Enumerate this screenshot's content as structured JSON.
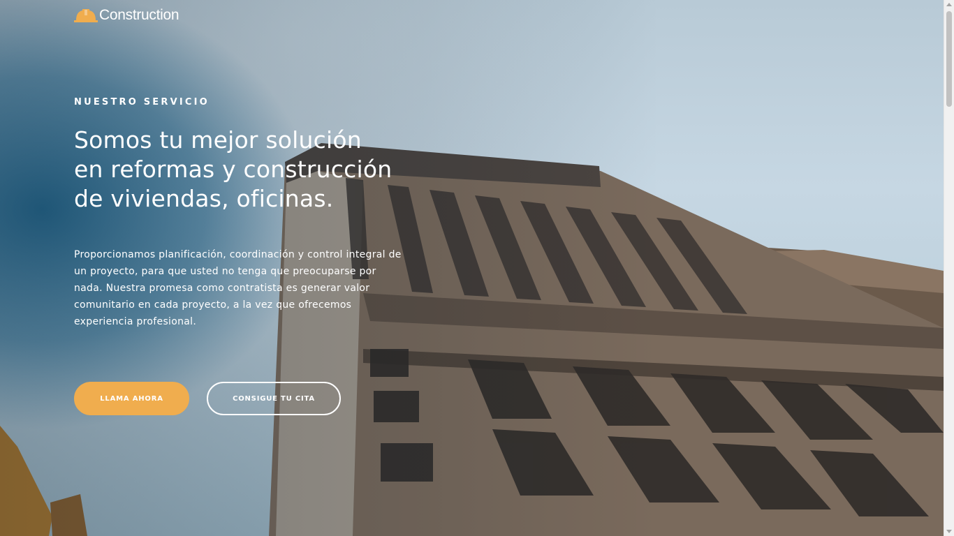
{
  "header": {
    "logo_text": "Construction",
    "logo_icon": "hard-hat-icon"
  },
  "hero": {
    "eyebrow": "NUESTRO SERVICIO",
    "headline": "Somos tu mejor solución en reformas y construcción de viviendas, oficinas.",
    "description": "Proporcionamos planificación, coordinación y control integral de un proyecto, para que usted no tenga que preocuparse por nada. Nuestra promesa como contratista es generar valor comunitario en cada proyecto, a la vez que ofrecemos experiencia profesional.",
    "primary_button": "LLAMA AHORA",
    "secondary_button": "CONSIGUE TU CITA"
  },
  "colors": {
    "accent": "#f0ad4e",
    "text": "#ffffff"
  }
}
